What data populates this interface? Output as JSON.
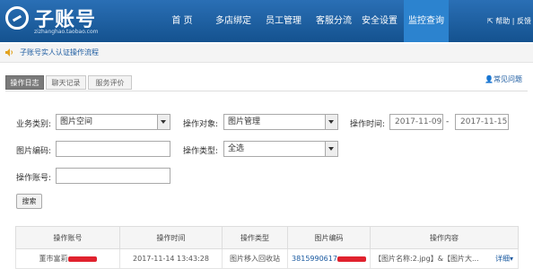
{
  "brand": {
    "title": "子账号",
    "subtitle": "zizhanghao.taobao.com"
  },
  "nav": [
    "首 页",
    "多店绑定",
    "员工管理",
    "客服分流",
    "安全设置",
    "监控查询"
  ],
  "topright": "帮助 | 反馈",
  "notice": "子账号实人认证操作流程",
  "tabs": [
    "操作日志",
    "聊天记录",
    "服务评价"
  ],
  "help_link": "常见问题",
  "form": {
    "biz_type_label": "业务类别:",
    "biz_type_value": "图片空间",
    "op_object_label": "操作对象:",
    "op_object_value": "图片管理",
    "op_time_label": "操作时间:",
    "date_start": "2017-11-09",
    "date_sep": "-",
    "date_end": "2017-11-15",
    "pic_code_label": "图片编码:",
    "op_type_label": "操作类型:",
    "op_type_value": "全选",
    "op_account_label": "操作账号:",
    "search_button": "搜索"
  },
  "table": {
    "headers": [
      "操作账号",
      "操作时间",
      "操作类型",
      "图片编码",
      "操作内容"
    ],
    "rows": [
      {
        "account": "董市富莉",
        "time": "2017-11-14 13:43:28",
        "type": "图片移入回收站",
        "code": "3815990617",
        "content": "【图片名称:2.jpg】&【图片大...",
        "action": "详细▾"
      }
    ]
  },
  "colors": {
    "topbar": "#1b5fa6",
    "active_nav": "#2c83cf",
    "link": "#1a5aa0",
    "redaction": "#e0222e"
  }
}
